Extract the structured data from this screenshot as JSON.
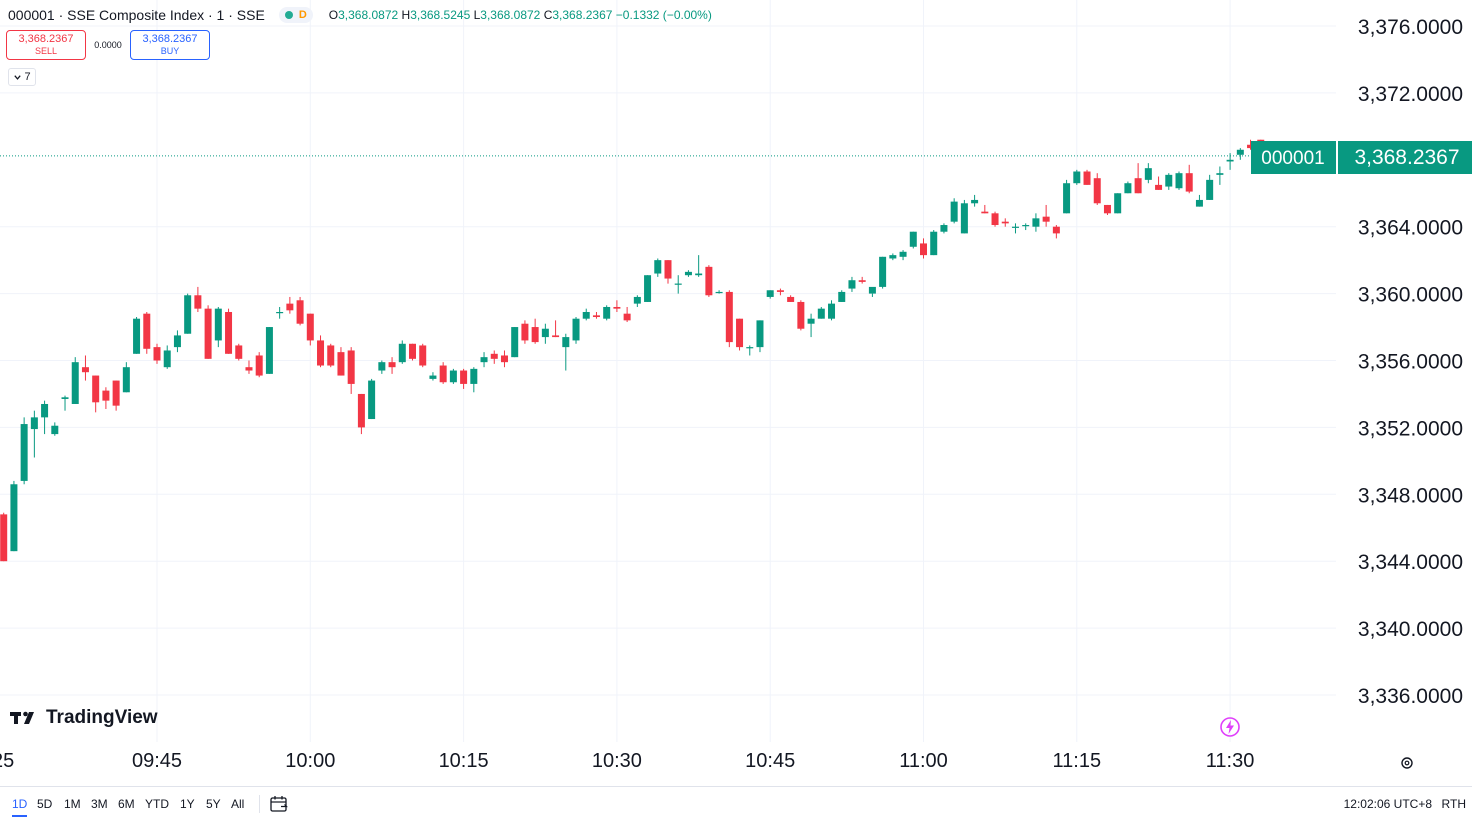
{
  "header": {
    "symbol_line": "000001 · SSE Composite Index · 1 · SSE",
    "status_badge": "D",
    "ohlc": {
      "o_label": "O",
      "o": "3,368.0872",
      "h_label": "H",
      "h": "3,368.5245",
      "l_label": "L",
      "l": "3,368.0872",
      "c_label": "C",
      "c": "3,368.2367",
      "change": "−0.1332 (−0.00%)"
    }
  },
  "trade": {
    "sell_price": "3,368.2367",
    "sell_label": "SELL",
    "spread": "0.0000",
    "buy_price": "3,368.2367",
    "buy_label": "BUY"
  },
  "indicators_toggle": {
    "count": "7"
  },
  "price_badge": {
    "symbol": "000001",
    "price": "3,368.2367"
  },
  "branding": {
    "logo_text": "TradingView"
  },
  "bottom_bar": {
    "ranges": [
      "1D",
      "5D",
      "1M",
      "3M",
      "6M",
      "YTD",
      "1Y",
      "5Y",
      "All"
    ],
    "active_range": "1D",
    "clock": "12:02:06 UTC+8",
    "session": "RTH"
  },
  "colors": {
    "up": "#089981",
    "down": "#f23645",
    "grid": "#f0f3fa",
    "accent": "#2962ff"
  },
  "chart_data": {
    "type": "candlestick",
    "interval": "1 minute",
    "y_ticks": [
      "3,376.0000",
      "3,372.0000",
      "3,364.0000",
      "3,360.0000",
      "3,356.0000",
      "3,352.0000",
      "3,348.0000",
      "3,344.0000",
      "3,340.0000",
      "3,336.0000"
    ],
    "y_tick_values": [
      3376,
      3372,
      3364,
      3360,
      3356,
      3352,
      3348,
      3344,
      3340,
      3336
    ],
    "x_ticks": [
      "25",
      "09:45",
      "10:00",
      "10:15",
      "10:30",
      "10:45",
      "11:00",
      "11:15",
      "11:30"
    ],
    "x_tick_minutes": [
      -15.5,
      0,
      15,
      30,
      45,
      60,
      75,
      90,
      105
    ],
    "ylim": [
      3334.5,
      3377.5
    ],
    "last_price": 3368.2367,
    "candles": [
      {
        "t": -15,
        "o": 3346.8,
        "h": 3346.9,
        "l": 3344.0,
        "c": 3344.0
      },
      {
        "t": -14,
        "o": 3344.6,
        "h": 3348.8,
        "l": 3344.6,
        "c": 3348.6
      },
      {
        "t": -13,
        "o": 3348.8,
        "h": 3352.6,
        "l": 3348.6,
        "c": 3352.2
      },
      {
        "t": -12,
        "o": 3351.9,
        "h": 3353.0,
        "l": 3350.2,
        "c": 3352.6
      },
      {
        "t": -11,
        "o": 3352.6,
        "h": 3353.6,
        "l": 3351.6,
        "c": 3353.4
      },
      {
        "t": -10,
        "o": 3351.6,
        "h": 3352.3,
        "l": 3351.5,
        "c": 3352.1
      },
      {
        "t": -9,
        "o": 3353.7,
        "h": 3353.9,
        "l": 3353.0,
        "c": 3353.8
      },
      {
        "t": -8,
        "o": 3353.4,
        "h": 3356.2,
        "l": 3353.4,
        "c": 3355.9
      },
      {
        "t": -7,
        "o": 3355.6,
        "h": 3356.3,
        "l": 3354.8,
        "c": 3355.3
      },
      {
        "t": -6,
        "o": 3355.1,
        "h": 3355.1,
        "l": 3352.9,
        "c": 3353.5
      },
      {
        "t": -5,
        "o": 3354.2,
        "h": 3354.4,
        "l": 3353.1,
        "c": 3353.6
      },
      {
        "t": -4,
        "o": 3354.8,
        "h": 3354.8,
        "l": 3353.0,
        "c": 3353.3
      },
      {
        "t": -3,
        "o": 3354.1,
        "h": 3355.9,
        "l": 3354.1,
        "c": 3355.6
      },
      {
        "t": -2,
        "o": 3356.4,
        "h": 3358.6,
        "l": 3356.4,
        "c": 3358.5
      },
      {
        "t": -1,
        "o": 3358.8,
        "h": 3358.9,
        "l": 3356.4,
        "c": 3356.7
      },
      {
        "t": 0,
        "o": 3356.8,
        "h": 3357.0,
        "l": 3355.8,
        "c": 3356.0
      },
      {
        "t": 1,
        "o": 3355.6,
        "h": 3356.9,
        "l": 3355.5,
        "c": 3356.6
      },
      {
        "t": 2,
        "o": 3356.8,
        "h": 3357.8,
        "l": 3356.5,
        "c": 3357.5
      },
      {
        "t": 3,
        "o": 3357.6,
        "h": 3360.0,
        "l": 3357.6,
        "c": 3359.9
      },
      {
        "t": 4,
        "o": 3359.9,
        "h": 3360.4,
        "l": 3358.9,
        "c": 3359.1
      },
      {
        "t": 5,
        "o": 3359.1,
        "h": 3359.3,
        "l": 3356.1,
        "c": 3356.1
      },
      {
        "t": 6,
        "o": 3357.2,
        "h": 3359.2,
        "l": 3356.8,
        "c": 3359.1
      },
      {
        "t": 7,
        "o": 3358.9,
        "h": 3359.1,
        "l": 3356.4,
        "c": 3356.4
      },
      {
        "t": 8,
        "o": 3356.9,
        "h": 3357.0,
        "l": 3356.0,
        "c": 3356.1
      },
      {
        "t": 9,
        "o": 3355.6,
        "h": 3356.0,
        "l": 3355.2,
        "c": 3355.4
      },
      {
        "t": 10,
        "o": 3356.3,
        "h": 3356.5,
        "l": 3355.0,
        "c": 3355.1
      },
      {
        "t": 11,
        "o": 3355.2,
        "h": 3358.0,
        "l": 3355.2,
        "c": 3358.0
      },
      {
        "t": 12,
        "o": 3358.9,
        "h": 3359.2,
        "l": 3358.5,
        "c": 3358.9
      },
      {
        "t": 13,
        "o": 3359.4,
        "h": 3359.8,
        "l": 3358.8,
        "c": 3359.0
      },
      {
        "t": 14,
        "o": 3359.6,
        "h": 3359.8,
        "l": 3358.1,
        "c": 3358.2
      },
      {
        "t": 15,
        "o": 3358.8,
        "h": 3358.8,
        "l": 3356.9,
        "c": 3357.2
      },
      {
        "t": 16,
        "o": 3357.2,
        "h": 3357.5,
        "l": 3355.6,
        "c": 3355.7
      },
      {
        "t": 17,
        "o": 3356.9,
        "h": 3357.0,
        "l": 3355.6,
        "c": 3355.7
      },
      {
        "t": 18,
        "o": 3356.5,
        "h": 3356.8,
        "l": 3355.1,
        "c": 3355.1
      },
      {
        "t": 19,
        "o": 3356.6,
        "h": 3356.8,
        "l": 3354.0,
        "c": 3354.6
      },
      {
        "t": 20,
        "o": 3354.0,
        "h": 3354.0,
        "l": 3351.6,
        "c": 3352.0
      },
      {
        "t": 21,
        "o": 3352.5,
        "h": 3354.9,
        "l": 3352.5,
        "c": 3354.8
      },
      {
        "t": 22,
        "o": 3355.4,
        "h": 3356.0,
        "l": 3355.2,
        "c": 3355.9
      },
      {
        "t": 23,
        "o": 3355.9,
        "h": 3356.2,
        "l": 3355.2,
        "c": 3355.6
      },
      {
        "t": 24,
        "o": 3355.9,
        "h": 3357.2,
        "l": 3355.8,
        "c": 3357.0
      },
      {
        "t": 25,
        "o": 3357.0,
        "h": 3357.0,
        "l": 3356.0,
        "c": 3356.1
      },
      {
        "t": 26,
        "o": 3356.9,
        "h": 3357.0,
        "l": 3355.6,
        "c": 3355.7
      },
      {
        "t": 27,
        "o": 3354.9,
        "h": 3355.3,
        "l": 3354.8,
        "c": 3355.1
      },
      {
        "t": 28,
        "o": 3355.7,
        "h": 3355.9,
        "l": 3354.6,
        "c": 3354.7
      },
      {
        "t": 29,
        "o": 3354.7,
        "h": 3355.5,
        "l": 3354.6,
        "c": 3355.4
      },
      {
        "t": 30,
        "o": 3355.4,
        "h": 3355.5,
        "l": 3354.3,
        "c": 3354.6
      },
      {
        "t": 31,
        "o": 3354.6,
        "h": 3355.6,
        "l": 3354.1,
        "c": 3355.5
      },
      {
        "t": 32,
        "o": 3355.9,
        "h": 3356.5,
        "l": 3355.6,
        "c": 3356.2
      },
      {
        "t": 33,
        "o": 3356.4,
        "h": 3356.6,
        "l": 3355.8,
        "c": 3356.1
      },
      {
        "t": 34,
        "o": 3356.3,
        "h": 3356.6,
        "l": 3355.6,
        "c": 3355.9
      },
      {
        "t": 35,
        "o": 3356.2,
        "h": 3358.0,
        "l": 3356.2,
        "c": 3358.0
      },
      {
        "t": 36,
        "o": 3358.2,
        "h": 3358.4,
        "l": 3357.0,
        "c": 3357.2
      },
      {
        "t": 37,
        "o": 3358.0,
        "h": 3358.5,
        "l": 3357.0,
        "c": 3357.1
      },
      {
        "t": 38,
        "o": 3357.4,
        "h": 3358.2,
        "l": 3357.0,
        "c": 3357.9
      },
      {
        "t": 39,
        "o": 3357.5,
        "h": 3358.4,
        "l": 3357.4,
        "c": 3357.4
      },
      {
        "t": 40,
        "o": 3356.8,
        "h": 3357.6,
        "l": 3355.4,
        "c": 3357.4
      },
      {
        "t": 41,
        "o": 3357.2,
        "h": 3358.6,
        "l": 3357.0,
        "c": 3358.5
      },
      {
        "t": 42,
        "o": 3358.5,
        "h": 3359.1,
        "l": 3358.4,
        "c": 3358.9
      },
      {
        "t": 43,
        "o": 3358.7,
        "h": 3358.9,
        "l": 3358.5,
        "c": 3358.6
      },
      {
        "t": 44,
        "o": 3358.5,
        "h": 3359.3,
        "l": 3358.4,
        "c": 3359.2
      },
      {
        "t": 45,
        "o": 3359.2,
        "h": 3359.6,
        "l": 3358.9,
        "c": 3359.1
      },
      {
        "t": 46,
        "o": 3358.8,
        "h": 3359.2,
        "l": 3358.3,
        "c": 3358.4
      },
      {
        "t": 47,
        "o": 3359.4,
        "h": 3359.9,
        "l": 3359.2,
        "c": 3359.8
      },
      {
        "t": 48,
        "o": 3359.5,
        "h": 3361.1,
        "l": 3359.5,
        "c": 3361.1
      },
      {
        "t": 49,
        "o": 3361.2,
        "h": 3362.1,
        "l": 3361.0,
        "c": 3362.0
      },
      {
        "t": 50,
        "o": 3362.0,
        "h": 3362.0,
        "l": 3360.6,
        "c": 3360.9
      },
      {
        "t": 51,
        "o": 3360.6,
        "h": 3361.1,
        "l": 3360.0,
        "c": 3360.6
      },
      {
        "t": 52,
        "o": 3361.1,
        "h": 3361.4,
        "l": 3361.0,
        "c": 3361.3
      },
      {
        "t": 53,
        "o": 3361.1,
        "h": 3362.3,
        "l": 3361.0,
        "c": 3361.2
      },
      {
        "t": 54,
        "o": 3361.6,
        "h": 3361.7,
        "l": 3359.8,
        "c": 3359.9
      },
      {
        "t": 55,
        "o": 3360.1,
        "h": 3360.2,
        "l": 3360.0,
        "c": 3360.1
      },
      {
        "t": 56,
        "o": 3360.1,
        "h": 3360.2,
        "l": 3356.8,
        "c": 3357.1
      },
      {
        "t": 57,
        "o": 3358.5,
        "h": 3358.5,
        "l": 3356.6,
        "c": 3356.8
      },
      {
        "t": 58,
        "o": 3356.8,
        "h": 3356.9,
        "l": 3356.3,
        "c": 3356.8
      },
      {
        "t": 59,
        "o": 3356.8,
        "h": 3358.4,
        "l": 3356.5,
        "c": 3358.4
      },
      {
        "t": 60,
        "o": 3359.8,
        "h": 3360.2,
        "l": 3359.7,
        "c": 3360.2
      },
      {
        "t": 61,
        "o": 3360.2,
        "h": 3360.3,
        "l": 3359.9,
        "c": 3360.1
      },
      {
        "t": 62,
        "o": 3359.8,
        "h": 3359.9,
        "l": 3359.5,
        "c": 3359.5
      },
      {
        "t": 63,
        "o": 3359.5,
        "h": 3359.6,
        "l": 3357.8,
        "c": 3357.9
      },
      {
        "t": 64,
        "o": 3358.2,
        "h": 3358.8,
        "l": 3357.4,
        "c": 3358.5
      },
      {
        "t": 65,
        "o": 3358.5,
        "h": 3359.2,
        "l": 3358.5,
        "c": 3359.1
      },
      {
        "t": 66,
        "o": 3358.5,
        "h": 3359.6,
        "l": 3358.4,
        "c": 3359.4
      },
      {
        "t": 67,
        "o": 3359.5,
        "h": 3360.2,
        "l": 3359.5,
        "c": 3360.1
      },
      {
        "t": 68,
        "o": 3360.3,
        "h": 3361.0,
        "l": 3360.1,
        "c": 3360.8
      },
      {
        "t": 69,
        "o": 3360.8,
        "h": 3361.0,
        "l": 3360.6,
        "c": 3360.7
      },
      {
        "t": 70,
        "o": 3360.0,
        "h": 3360.0,
        "l": 3359.8,
        "c": 3360.4
      },
      {
        "t": 71,
        "o": 3360.4,
        "h": 3362.2,
        "l": 3360.3,
        "c": 3362.2
      },
      {
        "t": 72,
        "o": 3362.1,
        "h": 3362.4,
        "l": 3362.0,
        "c": 3362.3
      },
      {
        "t": 73,
        "o": 3362.2,
        "h": 3362.6,
        "l": 3362.0,
        "c": 3362.5
      },
      {
        "t": 74,
        "o": 3362.8,
        "h": 3363.7,
        "l": 3362.7,
        "c": 3363.7
      },
      {
        "t": 75,
        "o": 3363.0,
        "h": 3363.3,
        "l": 3362.1,
        "c": 3362.3
      },
      {
        "t": 76,
        "o": 3362.3,
        "h": 3363.8,
        "l": 3362.3,
        "c": 3363.7
      },
      {
        "t": 77,
        "o": 3363.7,
        "h": 3364.2,
        "l": 3363.6,
        "c": 3364.1
      },
      {
        "t": 78,
        "o": 3364.3,
        "h": 3365.7,
        "l": 3364.2,
        "c": 3365.5
      },
      {
        "t": 79,
        "o": 3363.6,
        "h": 3365.6,
        "l": 3363.6,
        "c": 3365.4
      },
      {
        "t": 80,
        "o": 3365.4,
        "h": 3365.9,
        "l": 3365.2,
        "c": 3365.6
      },
      {
        "t": 81,
        "o": 3364.9,
        "h": 3365.3,
        "l": 3364.8,
        "c": 3364.8
      },
      {
        "t": 82,
        "o": 3364.8,
        "h": 3364.9,
        "l": 3364.0,
        "c": 3364.1
      },
      {
        "t": 83,
        "o": 3364.3,
        "h": 3364.5,
        "l": 3364.0,
        "c": 3364.2
      },
      {
        "t": 84,
        "o": 3364.0,
        "h": 3364.2,
        "l": 3363.6,
        "c": 3364.0
      },
      {
        "t": 85,
        "o": 3364.1,
        "h": 3364.2,
        "l": 3363.8,
        "c": 3364.1
      },
      {
        "t": 86,
        "o": 3364.0,
        "h": 3364.8,
        "l": 3363.7,
        "c": 3364.5
      },
      {
        "t": 87,
        "o": 3364.6,
        "h": 3365.3,
        "l": 3364.0,
        "c": 3364.3
      },
      {
        "t": 88,
        "o": 3364.0,
        "h": 3364.1,
        "l": 3363.3,
        "c": 3363.6
      },
      {
        "t": 89,
        "o": 3364.8,
        "h": 3366.8,
        "l": 3364.8,
        "c": 3366.6
      },
      {
        "t": 90,
        "o": 3366.6,
        "h": 3367.4,
        "l": 3366.5,
        "c": 3367.3
      },
      {
        "t": 91,
        "o": 3367.3,
        "h": 3367.4,
        "l": 3366.5,
        "c": 3366.5
      },
      {
        "t": 92,
        "o": 3366.9,
        "h": 3367.2,
        "l": 3365.3,
        "c": 3365.4
      },
      {
        "t": 93,
        "o": 3365.3,
        "h": 3365.3,
        "l": 3364.7,
        "c": 3364.8
      },
      {
        "t": 94,
        "o": 3364.8,
        "h": 3366.0,
        "l": 3364.8,
        "c": 3366.0
      },
      {
        "t": 95,
        "o": 3366.0,
        "h": 3366.7,
        "l": 3366.0,
        "c": 3366.6
      },
      {
        "t": 96,
        "o": 3366.9,
        "h": 3367.8,
        "l": 3366.0,
        "c": 3366.0
      },
      {
        "t": 97,
        "o": 3366.8,
        "h": 3367.8,
        "l": 3366.6,
        "c": 3367.5
      },
      {
        "t": 98,
        "o": 3366.5,
        "h": 3367.0,
        "l": 3366.2,
        "c": 3366.2
      },
      {
        "t": 99,
        "o": 3366.4,
        "h": 3367.2,
        "l": 3366.2,
        "c": 3367.1
      },
      {
        "t": 100,
        "o": 3366.3,
        "h": 3367.3,
        "l": 3366.2,
        "c": 3367.2
      },
      {
        "t": 101,
        "o": 3367.2,
        "h": 3367.7,
        "l": 3366.0,
        "c": 3366.1
      },
      {
        "t": 102,
        "o": 3365.2,
        "h": 3365.9,
        "l": 3365.2,
        "c": 3365.6
      },
      {
        "t": 103,
        "o": 3365.6,
        "h": 3367.1,
        "l": 3365.6,
        "c": 3366.8
      },
      {
        "t": 104,
        "o": 3367.1,
        "h": 3367.6,
        "l": 3366.5,
        "c": 3367.2
      },
      {
        "t": 105,
        "o": 3367.9,
        "h": 3368.4,
        "l": 3367.4,
        "c": 3368.0
      },
      {
        "t": 106,
        "o": 3368.3,
        "h": 3368.7,
        "l": 3368.0,
        "c": 3368.6
      },
      {
        "t": 107,
        "o": 3368.9,
        "h": 3369.2,
        "l": 3368.6,
        "c": 3368.7
      },
      {
        "t": 108,
        "o": 3369.2,
        "h": 3369.2,
        "l": 3367.9,
        "c": 3368.0
      },
      {
        "t": 109,
        "o": 3368.0872,
        "h": 3368.5245,
        "l": 3368.0872,
        "c": 3368.2367
      }
    ]
  }
}
